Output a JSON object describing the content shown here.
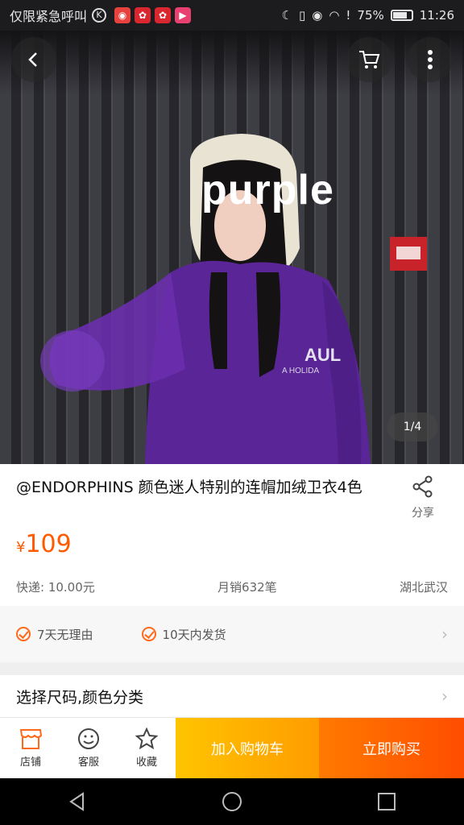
{
  "status_bar": {
    "carrier": "仅限紧急呼叫",
    "battery": "75%",
    "time": "11:26",
    "icons": [
      "weibo-icon",
      "huawei-icon",
      "huawei-icon",
      "video-icon"
    ]
  },
  "hero": {
    "caption": "purple",
    "page_indicator": "1/4"
  },
  "product": {
    "title": "@ENDORPHINS 颜色迷人特别的连帽加绒卫衣4色",
    "share_label": "分享",
    "currency": "¥",
    "price": "109",
    "shipping": "快递: 10.00元",
    "sales": "月销632笔",
    "location": "湖北武汉"
  },
  "guarantees": [
    {
      "label": "7天无理由"
    },
    {
      "label": "10天内发货"
    }
  ],
  "select_options_label": "选择尺码,颜色分类",
  "action_bar": {
    "tabs": [
      {
        "label": "店铺",
        "icon": "store-icon"
      },
      {
        "label": "客服",
        "icon": "chat-icon"
      },
      {
        "label": "收藏",
        "icon": "star-icon"
      }
    ],
    "add_to_cart": "加入购物车",
    "buy_now": "立即购买"
  },
  "colors": {
    "accent": "#ff5a00",
    "cart_button": "#ffb300",
    "buy_button": "#ff5a00"
  }
}
